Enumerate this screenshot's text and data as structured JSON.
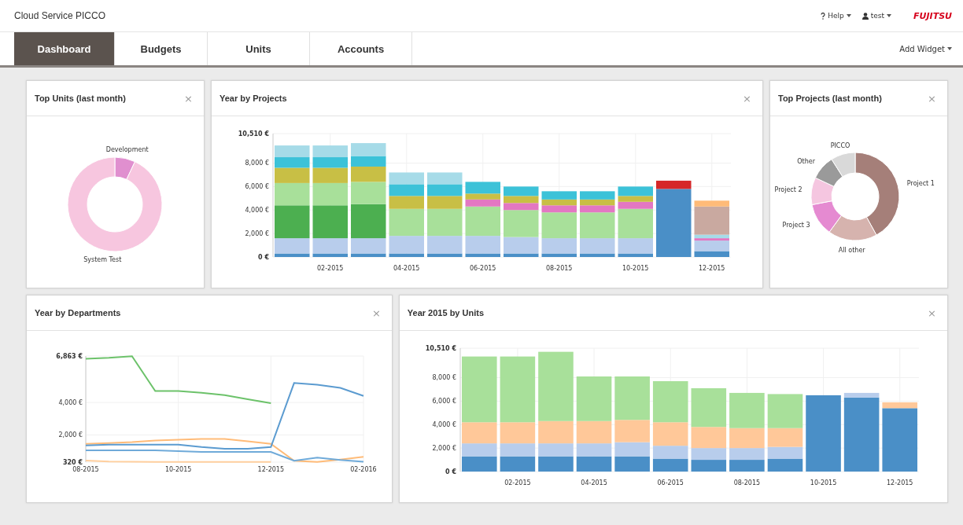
{
  "app": {
    "title": "Cloud Service PICCO"
  },
  "header_menus": [
    {
      "kind": "help",
      "label": "Help"
    },
    {
      "kind": "user",
      "label": "test"
    }
  ],
  "logo": "FUJITSU",
  "tabs": [
    {
      "label": "Dashboard",
      "selected": true
    },
    {
      "label": "Budgets",
      "selected": false
    },
    {
      "label": "Units",
      "selected": false
    },
    {
      "label": "Accounts",
      "selected": false
    }
  ],
  "add_widget": "Add Widget",
  "widgets": [
    {
      "title": "Top Units (last month)",
      "close": "×",
      "chart_data": {
        "type": "donut",
        "categories": [
          "Development",
          "System Test"
        ],
        "values": [
          7,
          93
        ],
        "colors": [
          "#e08fcf",
          "#f7c6df"
        ]
      }
    },
    {
      "title": "Year by Projects",
      "close": "×",
      "chart_data": {
        "type": "bar",
        "stacked": true,
        "grid": true,
        "categories": [
          null,
          "02-2015",
          null,
          "04-2015",
          null,
          "06-2015",
          null,
          "08-2015",
          null,
          "10-2015",
          null,
          "12-2015"
        ],
        "ylim": [
          0,
          10510
        ],
        "yticks": [
          {
            "value": 0,
            "label": "0 €"
          },
          {
            "value": 2000,
            "label": "2,000 €"
          },
          {
            "value": 4000,
            "label": "4,000 €"
          },
          {
            "value": 6000,
            "label": "6,000 €"
          },
          {
            "value": 8000,
            "label": "8,000 €"
          },
          {
            "value": 10510,
            "label": "10,510 €"
          }
        ],
        "series": [
          {
            "color": "#4a8fc7",
            "values": [
              300,
              300,
              300,
              300,
              300,
              300,
              300,
              300,
              300,
              300,
              5800,
              500
            ]
          },
          {
            "color": "#b8cdec",
            "values": [
              1300,
              1300,
              1300,
              1500,
              1500,
              1500,
              1400,
              1300,
              1300,
              1300,
              0,
              900
            ]
          },
          {
            "color": "#4caf50",
            "values": [
              2800,
              2800,
              2900,
              0,
              0,
              0,
              0,
              0,
              0,
              0,
              0,
              0
            ]
          },
          {
            "color": "#a8e09a",
            "values": [
              1900,
              1900,
              1900,
              2300,
              2300,
              2500,
              2300,
              2200,
              2200,
              2500,
              0,
              0
            ]
          },
          {
            "color": "#e377c2",
            "values": [
              0,
              0,
              0,
              0,
              0,
              600,
              600,
              600,
              600,
              600,
              0,
              200
            ]
          },
          {
            "color": "#c8bf45",
            "values": [
              1300,
              1300,
              1300,
              1100,
              1100,
              500,
              600,
              500,
              500,
              500,
              0,
              0
            ]
          },
          {
            "color": "#3cc2d8",
            "values": [
              900,
              900,
              900,
              1000,
              1000,
              1000,
              800,
              700,
              700,
              800,
              0,
              0
            ]
          },
          {
            "color": "#a6dbe8",
            "values": [
              1000,
              1000,
              1100,
              1000,
              1000,
              0,
              0,
              0,
              0,
              0,
              0,
              300
            ]
          },
          {
            "color": "#d62728",
            "values": [
              0,
              0,
              0,
              0,
              0,
              0,
              0,
              0,
              0,
              0,
              700,
              0
            ]
          },
          {
            "color": "#c9a9a0",
            "values": [
              0,
              0,
              0,
              0,
              0,
              0,
              0,
              0,
              0,
              0,
              0,
              2400
            ]
          },
          {
            "color": "#ffbb78",
            "values": [
              0,
              0,
              0,
              0,
              0,
              0,
              0,
              0,
              0,
              0,
              0,
              500
            ]
          }
        ]
      }
    },
    {
      "title": "Top Projects (last month)",
      "close": "×",
      "chart_data": {
        "type": "donut",
        "categories": [
          "Project 1",
          "All other",
          "Project 3",
          "Project 2",
          "Other",
          "PICCO"
        ],
        "values": [
          42,
          18,
          12,
          10,
          9,
          9
        ],
        "colors": [
          "#a57f79",
          "#d6b3ae",
          "#e58ad1",
          "#f5c6e0",
          "#9a9a9a",
          "#d9d9d9"
        ]
      }
    },
    {
      "title": "Year by Departments",
      "close": "×",
      "chart_data": {
        "type": "line",
        "grid": true,
        "categories": [
          "08-2015",
          null,
          null,
          null,
          "10-2015",
          null,
          null,
          null,
          "12-2015",
          null,
          null,
          null,
          "02-2016"
        ],
        "ylim": [
          320,
          6863
        ],
        "yticks": [
          {
            "value": 320,
            "label": "320 €"
          },
          {
            "value": 2000,
            "label": "2,000 €"
          },
          {
            "value": 4000,
            "label": "4,000 €"
          },
          {
            "value": 6863,
            "label": "6,863 €"
          }
        ],
        "series": [
          {
            "color": "#6cc26a",
            "values": [
              6700,
              6750,
              6850,
              4700,
              4700,
              4600,
              4450,
              4200,
              3950,
              null,
              null,
              null,
              null
            ]
          },
          {
            "color": "#ffbb78",
            "values": [
              1450,
              1500,
              1550,
              1650,
              1700,
              1750,
              1750,
              1600,
              1450,
              400,
              330,
              480,
              650
            ]
          },
          {
            "color": "#ffcf9e",
            "values": [
              420,
              360,
              340,
              330,
              330,
              330,
              330,
              330,
              330,
              null,
              null,
              null,
              null
            ]
          },
          {
            "color": "#5b9bd0",
            "values": [
              1350,
              1400,
              1400,
              1400,
              1400,
              1250,
              1150,
              1150,
              1250,
              5200,
              5100,
              4900,
              4400
            ]
          },
          {
            "color": "#6faad9",
            "values": [
              1050,
              1050,
              1050,
              1050,
              1000,
              950,
              950,
              950,
              950,
              400,
              600,
              450,
              350
            ]
          }
        ]
      }
    },
    {
      "title": "Year 2015 by Units",
      "close": "×",
      "chart_data": {
        "type": "bar",
        "stacked": true,
        "grid": true,
        "categories": [
          null,
          "02-2015",
          null,
          "04-2015",
          null,
          "06-2015",
          null,
          "08-2015",
          null,
          "10-2015",
          null,
          "12-2015"
        ],
        "ylim": [
          0,
          10510
        ],
        "yticks": [
          {
            "value": 0,
            "label": "0 €"
          },
          {
            "value": 2000,
            "label": "2,000 €"
          },
          {
            "value": 4000,
            "label": "4,000 €"
          },
          {
            "value": 6000,
            "label": "6,000 €"
          },
          {
            "value": 8000,
            "label": "8,000 €"
          },
          {
            "value": 10510,
            "label": "10,510 €"
          }
        ],
        "series": [
          {
            "color": "#4a8fc7",
            "values": [
              1300,
              1300,
              1300,
              1300,
              1300,
              1100,
              1000,
              1000,
              1100,
              6500,
              6300,
              5400
            ]
          },
          {
            "color": "#b8cdec",
            "values": [
              1100,
              1100,
              1100,
              1100,
              1200,
              1100,
              1000,
              1000,
              1000,
              0,
              400,
              0
            ]
          },
          {
            "color": "#ffc899",
            "values": [
              1800,
              1800,
              1900,
              1900,
              1900,
              2000,
              1800,
              1700,
              1600,
              0,
              0,
              500
            ]
          },
          {
            "color": "#a8e09a",
            "values": [
              5600,
              5600,
              5900,
              3800,
              3700,
              3500,
              3300,
              3000,
              2900,
              0,
              0,
              0
            ]
          }
        ]
      }
    }
  ]
}
